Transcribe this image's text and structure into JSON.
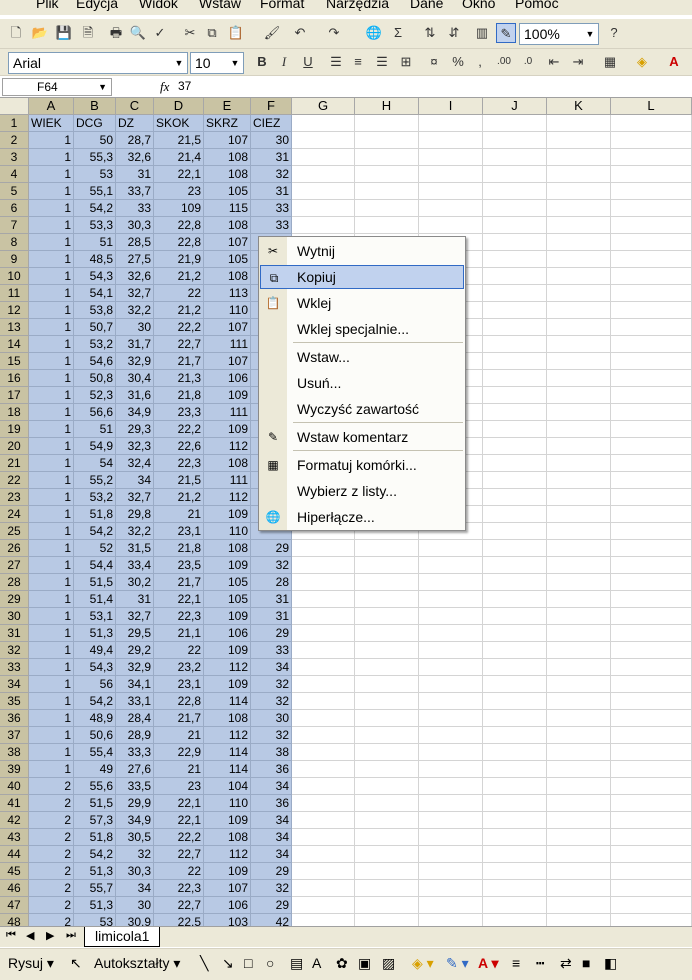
{
  "menu": [
    "Plik",
    "Edycja",
    "Widok",
    "Wstaw",
    "Format",
    "Narzędzia",
    "Dane",
    "Okno",
    "Pomoc"
  ],
  "toolbar": {
    "zoom": "100%",
    "font": "Arial",
    "size": "10"
  },
  "formula_bar": {
    "name_box": "F64",
    "fx": "fx",
    "content": "37"
  },
  "columns": [
    "A",
    "B",
    "C",
    "D",
    "E",
    "F",
    "G",
    "H",
    "I",
    "J",
    "K",
    "L"
  ],
  "rows": [
    [
      "WIEK",
      "DCG",
      "DZ",
      "SKOK",
      "SKRZ",
      "CIEZ"
    ],
    [
      "1",
      "50",
      "28,7",
      "21,5",
      "107",
      "30"
    ],
    [
      "1",
      "55,3",
      "32,6",
      "21,4",
      "108",
      "31"
    ],
    [
      "1",
      "53",
      "31",
      "22,1",
      "108",
      "32"
    ],
    [
      "1",
      "55,1",
      "33,7",
      "23",
      "105",
      "31"
    ],
    [
      "1",
      "54,2",
      "33",
      "109",
      "115",
      "33"
    ],
    [
      "1",
      "53,3",
      "30,3",
      "22,8",
      "108",
      "33"
    ],
    [
      "1",
      "51",
      "28,5",
      "22,8",
      "107",
      ""
    ],
    [
      "1",
      "48,5",
      "27,5",
      "21,9",
      "105",
      ""
    ],
    [
      "1",
      "54,3",
      "32,6",
      "21,2",
      "108",
      ""
    ],
    [
      "1",
      "54,1",
      "32,7",
      "22",
      "113",
      ""
    ],
    [
      "1",
      "53,8",
      "32,2",
      "21,2",
      "110",
      ""
    ],
    [
      "1",
      "50,7",
      "30",
      "22,2",
      "107",
      ""
    ],
    [
      "1",
      "53,2",
      "31,7",
      "22,7",
      "111",
      ""
    ],
    [
      "1",
      "54,6",
      "32,9",
      "21,7",
      "107",
      ""
    ],
    [
      "1",
      "50,8",
      "30,4",
      "21,3",
      "106",
      ""
    ],
    [
      "1",
      "52,3",
      "31,6",
      "21,8",
      "109",
      ""
    ],
    [
      "1",
      "56,6",
      "34,9",
      "23,3",
      "111",
      ""
    ],
    [
      "1",
      "51",
      "29,3",
      "22,2",
      "109",
      ""
    ],
    [
      "1",
      "54,9",
      "32,3",
      "22,6",
      "112",
      ""
    ],
    [
      "1",
      "54",
      "32,4",
      "22,3",
      "108",
      ""
    ],
    [
      "1",
      "55,2",
      "34",
      "21,5",
      "111",
      ""
    ],
    [
      "1",
      "53,2",
      "32,7",
      "21,2",
      "112",
      ""
    ],
    [
      "1",
      "51,8",
      "29,8",
      "21",
      "109",
      ""
    ],
    [
      "1",
      "54,2",
      "32,2",
      "23,1",
      "110",
      ""
    ],
    [
      "1",
      "52",
      "31,5",
      "21,8",
      "108",
      "29"
    ],
    [
      "1",
      "54,4",
      "33,4",
      "23,5",
      "109",
      "32"
    ],
    [
      "1",
      "51,5",
      "30,2",
      "21,7",
      "105",
      "28"
    ],
    [
      "1",
      "51,4",
      "31",
      "22,1",
      "105",
      "31"
    ],
    [
      "1",
      "53,1",
      "32,7",
      "22,3",
      "109",
      "31"
    ],
    [
      "1",
      "51,3",
      "29,5",
      "21,1",
      "106",
      "29"
    ],
    [
      "1",
      "49,4",
      "29,2",
      "22",
      "109",
      "33"
    ],
    [
      "1",
      "54,3",
      "32,9",
      "23,2",
      "112",
      "34"
    ],
    [
      "1",
      "56",
      "34,1",
      "23,1",
      "109",
      "32"
    ],
    [
      "1",
      "54,2",
      "33,1",
      "22,8",
      "114",
      "32"
    ],
    [
      "1",
      "48,9",
      "28,4",
      "21,7",
      "108",
      "30"
    ],
    [
      "1",
      "50,6",
      "28,9",
      "21",
      "112",
      "32"
    ],
    [
      "1",
      "55,4",
      "33,3",
      "22,9",
      "114",
      "38"
    ],
    [
      "1",
      "49",
      "27,6",
      "21",
      "114",
      "36"
    ],
    [
      "2",
      "55,6",
      "33,5",
      "23",
      "104",
      "34"
    ],
    [
      "2",
      "51,5",
      "29,9",
      "22,1",
      "110",
      "36"
    ],
    [
      "2",
      "57,3",
      "34,9",
      "22,1",
      "109",
      "34"
    ],
    [
      "2",
      "51,8",
      "30,5",
      "22,2",
      "108",
      "34"
    ],
    [
      "2",
      "54,2",
      "32",
      "22,7",
      "112",
      "34"
    ],
    [
      "2",
      "51,3",
      "30,3",
      "22",
      "109",
      "29"
    ],
    [
      "2",
      "55,7",
      "34",
      "22,3",
      "107",
      "32"
    ],
    [
      "2",
      "51,3",
      "30",
      "22,7",
      "106",
      "29"
    ],
    [
      "2",
      "53",
      "30,9",
      "22,5",
      "103",
      "42"
    ]
  ],
  "context_menu": [
    {
      "label": "Wytnij",
      "icon": "scissors-icon",
      "glyph": "✂"
    },
    {
      "label": "Kopiuj",
      "icon": "copy-icon",
      "glyph": "⧉"
    },
    {
      "label": "Wklej",
      "icon": "paste-icon",
      "glyph": "📋"
    },
    {
      "label": "Wklej specjalnie...",
      "icon": "",
      "glyph": ""
    },
    {
      "label": "Wstaw...",
      "icon": "",
      "glyph": ""
    },
    {
      "label": "Usuń...",
      "icon": "",
      "glyph": ""
    },
    {
      "label": "Wyczyść zawartość",
      "icon": "",
      "glyph": ""
    },
    {
      "label": "Wstaw komentarz",
      "icon": "comment-icon",
      "glyph": "✎"
    },
    {
      "label": "Formatuj komórki...",
      "icon": "format-cells-icon",
      "glyph": "▦"
    },
    {
      "label": "Wybierz z listy...",
      "icon": "",
      "glyph": ""
    },
    {
      "label": "Hiperłącze...",
      "icon": "hyperlink-icon",
      "glyph": "🌐"
    }
  ],
  "sheet_tab": "limicola1",
  "draw_toolbar": {
    "draw": "Rysuj",
    "autoshapes": "Autokształty"
  }
}
